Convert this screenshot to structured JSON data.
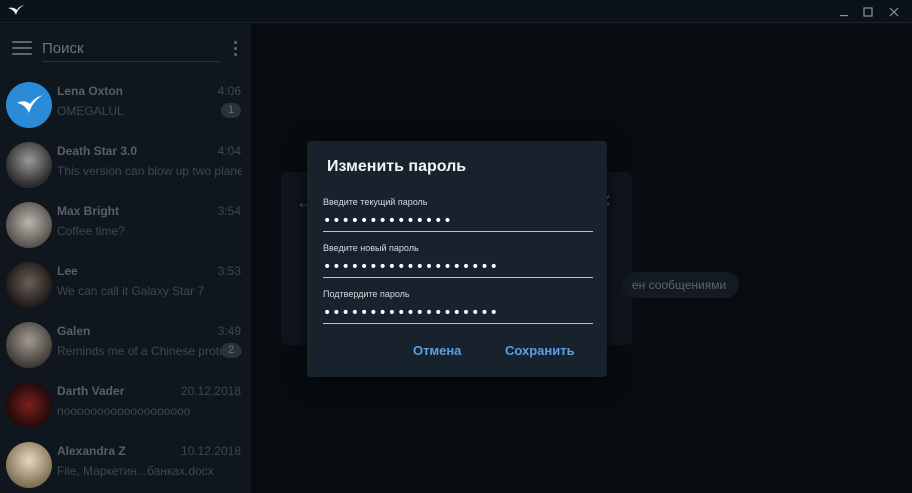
{
  "window": {
    "icons": {
      "logo": "swift-bird-logo",
      "minimize": "minimize-icon",
      "maximize": "maximize-icon",
      "close": "close-icon"
    }
  },
  "sidebar": {
    "search_placeholder": "Поиск",
    "chats": [
      {
        "name": "Lena Oxton",
        "time": "4:06",
        "preview": "OMEGALUL",
        "badge": "1",
        "avatar_color": "#2a8bd6"
      },
      {
        "name": "Death Star 3.0",
        "time": "4:04",
        "preview": "This version can blow up two planets",
        "badge": "",
        "avatar_color": "#6f6f6f"
      },
      {
        "name": "Max Bright",
        "time": "3:54",
        "preview": "Coffee time?",
        "badge": "",
        "avatar_color": "#8a8680"
      },
      {
        "name": "Lee",
        "time": "3:53",
        "preview": "We can call it Galaxy Star 7",
        "badge": "",
        "avatar_color": "#3b3432"
      },
      {
        "name": "Galen",
        "time": "3:49",
        "preview": "Reminds me of a Chinese prototype",
        "badge": "2",
        "avatar_color": "#6e6a64"
      },
      {
        "name": "Darth Vader",
        "time": "20.12.2018",
        "preview": "nooooooooooooooooooo",
        "badge": "",
        "avatar_color": "#5a1717"
      },
      {
        "name": "Alexandra Z",
        "time": "10.12.2018",
        "preview": "File, Маркетин...банках.docx",
        "badge": "",
        "avatar_color": "#c9b58f"
      }
    ]
  },
  "background": {
    "chip_text": "ен сообщениями"
  },
  "dialog": {
    "title": "Изменить пароль",
    "fields": [
      {
        "label": "Введите текущий пароль",
        "value": "••••••••••••••"
      },
      {
        "label": "Введите новый пароль",
        "value": "•••••••••••••••••••"
      },
      {
        "label": "Подтвердите пароль",
        "value": "•••••••••••••••••••"
      }
    ],
    "cancel_label": "Отмена",
    "save_label": "Сохранить",
    "accent_color": "#5aa0e3"
  }
}
